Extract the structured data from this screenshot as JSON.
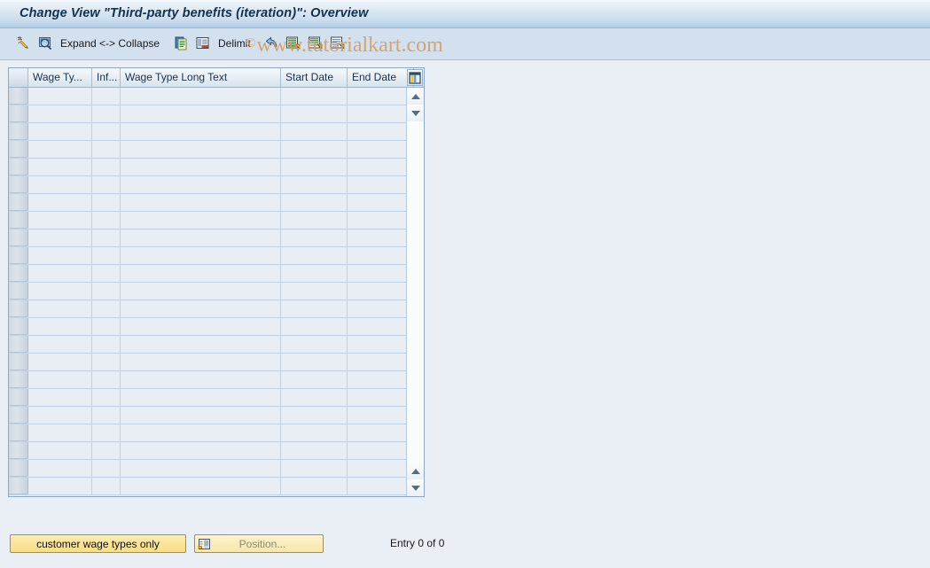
{
  "window": {
    "title": "Change View \"Third-party benefits (iteration)\": Overview"
  },
  "toolbar": {
    "items": [
      {
        "name": "change-display-icon",
        "icon": "pencil-magnifier",
        "label": ""
      },
      {
        "name": "display-detail-icon",
        "icon": "magnifier-screen",
        "label": ""
      },
      {
        "name": "expand-collapse-button",
        "icon": "",
        "label": "Expand <-> Collapse"
      },
      {
        "name": "copy-as-icon",
        "icon": "copy-pages",
        "label": ""
      },
      {
        "name": "delete-icon",
        "icon": "list-delete",
        "label": ""
      },
      {
        "name": "delimit-button",
        "icon": "",
        "label": "Delimit"
      },
      {
        "name": "previous-icon",
        "icon": "blue-arrow",
        "label": ""
      },
      {
        "name": "select-all-icon",
        "icon": "list-select-all",
        "label": ""
      },
      {
        "name": "select-block-icon",
        "icon": "list-select-block",
        "label": ""
      },
      {
        "name": "deselect-all-icon",
        "icon": "list-deselect",
        "label": ""
      }
    ]
  },
  "watermark": {
    "copyright": "©",
    "text": "www.tutorialkart.com",
    "color": "#d79a5b"
  },
  "table": {
    "columns": [
      {
        "name": "row-selector",
        "label": ""
      },
      {
        "name": "wage-type",
        "label": "Wage Ty..."
      },
      {
        "name": "infotype",
        "label": "Inf..."
      },
      {
        "name": "wage-type-long-text",
        "label": "Wage Type Long Text"
      },
      {
        "name": "start-date",
        "label": "Start Date"
      },
      {
        "name": "end-date",
        "label": "End Date"
      }
    ],
    "rows": [],
    "empty_row_count": 23,
    "config_icon": "table-settings-icon"
  },
  "scrollbar": {
    "up_icon": "scroll-up-icon",
    "down_icon": "scroll-down-icon"
  },
  "footer": {
    "customer_wage_types_label": "customer wage types only",
    "position_label": "Position...",
    "position_icon": "position-icon",
    "entry_status": "Entry 0 of 0"
  }
}
